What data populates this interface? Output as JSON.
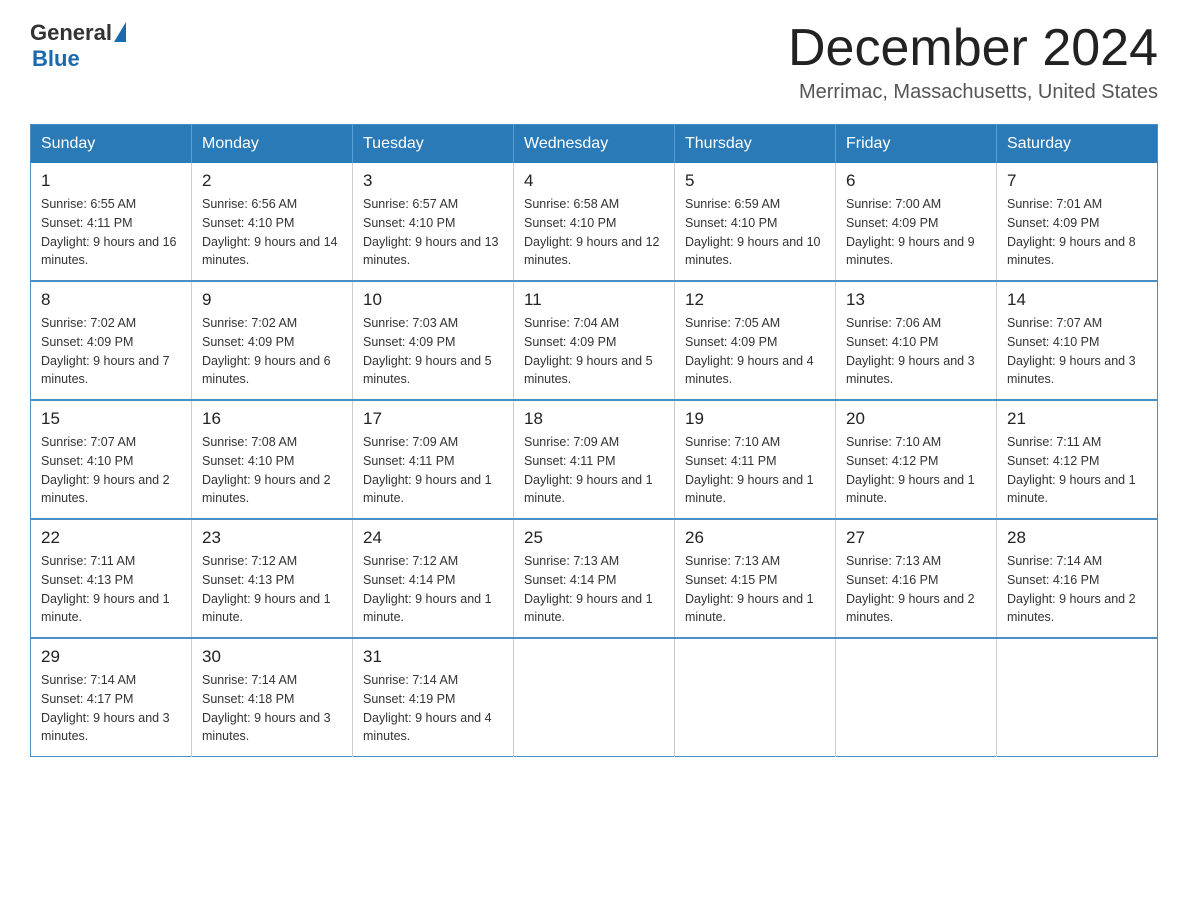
{
  "header": {
    "logo_general": "General",
    "logo_blue": "Blue",
    "month_title": "December 2024",
    "location": "Merrimac, Massachusetts, United States"
  },
  "days_of_week": [
    "Sunday",
    "Monday",
    "Tuesday",
    "Wednesday",
    "Thursday",
    "Friday",
    "Saturday"
  ],
  "weeks": [
    [
      {
        "day": "1",
        "sunrise": "6:55 AM",
        "sunset": "4:11 PM",
        "daylight": "9 hours and 16 minutes."
      },
      {
        "day": "2",
        "sunrise": "6:56 AM",
        "sunset": "4:10 PM",
        "daylight": "9 hours and 14 minutes."
      },
      {
        "day": "3",
        "sunrise": "6:57 AM",
        "sunset": "4:10 PM",
        "daylight": "9 hours and 13 minutes."
      },
      {
        "day": "4",
        "sunrise": "6:58 AM",
        "sunset": "4:10 PM",
        "daylight": "9 hours and 12 minutes."
      },
      {
        "day": "5",
        "sunrise": "6:59 AM",
        "sunset": "4:10 PM",
        "daylight": "9 hours and 10 minutes."
      },
      {
        "day": "6",
        "sunrise": "7:00 AM",
        "sunset": "4:09 PM",
        "daylight": "9 hours and 9 minutes."
      },
      {
        "day": "7",
        "sunrise": "7:01 AM",
        "sunset": "4:09 PM",
        "daylight": "9 hours and 8 minutes."
      }
    ],
    [
      {
        "day": "8",
        "sunrise": "7:02 AM",
        "sunset": "4:09 PM",
        "daylight": "9 hours and 7 minutes."
      },
      {
        "day": "9",
        "sunrise": "7:02 AM",
        "sunset": "4:09 PM",
        "daylight": "9 hours and 6 minutes."
      },
      {
        "day": "10",
        "sunrise": "7:03 AM",
        "sunset": "4:09 PM",
        "daylight": "9 hours and 5 minutes."
      },
      {
        "day": "11",
        "sunrise": "7:04 AM",
        "sunset": "4:09 PM",
        "daylight": "9 hours and 5 minutes."
      },
      {
        "day": "12",
        "sunrise": "7:05 AM",
        "sunset": "4:09 PM",
        "daylight": "9 hours and 4 minutes."
      },
      {
        "day": "13",
        "sunrise": "7:06 AM",
        "sunset": "4:10 PM",
        "daylight": "9 hours and 3 minutes."
      },
      {
        "day": "14",
        "sunrise": "7:07 AM",
        "sunset": "4:10 PM",
        "daylight": "9 hours and 3 minutes."
      }
    ],
    [
      {
        "day": "15",
        "sunrise": "7:07 AM",
        "sunset": "4:10 PM",
        "daylight": "9 hours and 2 minutes."
      },
      {
        "day": "16",
        "sunrise": "7:08 AM",
        "sunset": "4:10 PM",
        "daylight": "9 hours and 2 minutes."
      },
      {
        "day": "17",
        "sunrise": "7:09 AM",
        "sunset": "4:11 PM",
        "daylight": "9 hours and 1 minute."
      },
      {
        "day": "18",
        "sunrise": "7:09 AM",
        "sunset": "4:11 PM",
        "daylight": "9 hours and 1 minute."
      },
      {
        "day": "19",
        "sunrise": "7:10 AM",
        "sunset": "4:11 PM",
        "daylight": "9 hours and 1 minute."
      },
      {
        "day": "20",
        "sunrise": "7:10 AM",
        "sunset": "4:12 PM",
        "daylight": "9 hours and 1 minute."
      },
      {
        "day": "21",
        "sunrise": "7:11 AM",
        "sunset": "4:12 PM",
        "daylight": "9 hours and 1 minute."
      }
    ],
    [
      {
        "day": "22",
        "sunrise": "7:11 AM",
        "sunset": "4:13 PM",
        "daylight": "9 hours and 1 minute."
      },
      {
        "day": "23",
        "sunrise": "7:12 AM",
        "sunset": "4:13 PM",
        "daylight": "9 hours and 1 minute."
      },
      {
        "day": "24",
        "sunrise": "7:12 AM",
        "sunset": "4:14 PM",
        "daylight": "9 hours and 1 minute."
      },
      {
        "day": "25",
        "sunrise": "7:13 AM",
        "sunset": "4:14 PM",
        "daylight": "9 hours and 1 minute."
      },
      {
        "day": "26",
        "sunrise": "7:13 AM",
        "sunset": "4:15 PM",
        "daylight": "9 hours and 1 minute."
      },
      {
        "day": "27",
        "sunrise": "7:13 AM",
        "sunset": "4:16 PM",
        "daylight": "9 hours and 2 minutes."
      },
      {
        "day": "28",
        "sunrise": "7:14 AM",
        "sunset": "4:16 PM",
        "daylight": "9 hours and 2 minutes."
      }
    ],
    [
      {
        "day": "29",
        "sunrise": "7:14 AM",
        "sunset": "4:17 PM",
        "daylight": "9 hours and 3 minutes."
      },
      {
        "day": "30",
        "sunrise": "7:14 AM",
        "sunset": "4:18 PM",
        "daylight": "9 hours and 3 minutes."
      },
      {
        "day": "31",
        "sunrise": "7:14 AM",
        "sunset": "4:19 PM",
        "daylight": "9 hours and 4 minutes."
      },
      null,
      null,
      null,
      null
    ]
  ]
}
